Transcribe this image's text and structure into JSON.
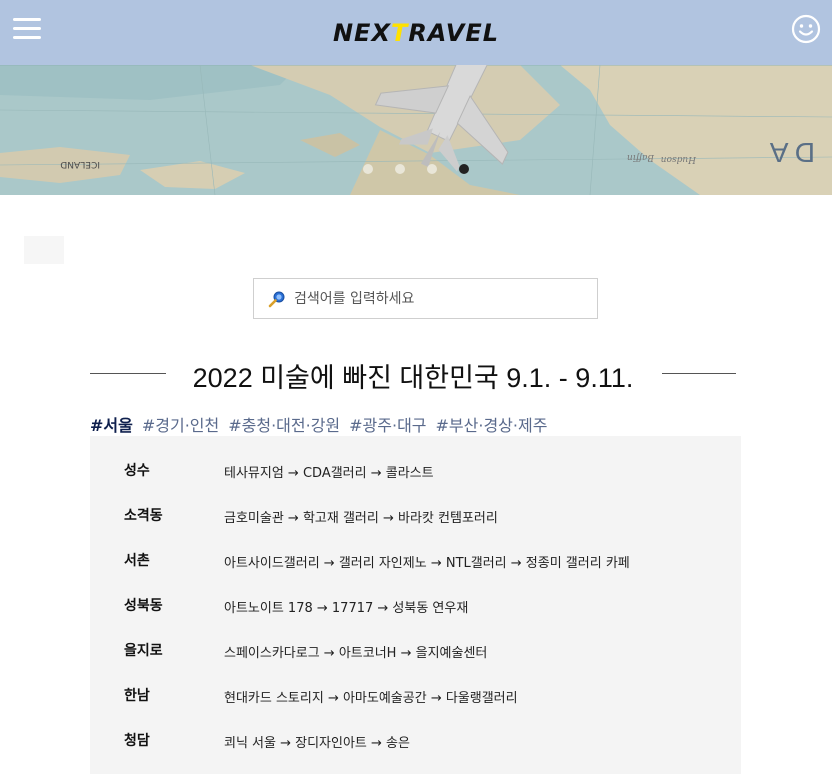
{
  "header": {
    "logo_prefix": "NEX",
    "logo_accent": "T",
    "logo_suffix": "RAVEL",
    "menu_icon": "hamburger-menu-icon",
    "profile_icon": "smiley-face-icon"
  },
  "banner": {
    "map_labels": [
      "ICELAND",
      "Baffin",
      "Hudson",
      "D A"
    ],
    "dots": [
      false,
      false,
      false,
      true
    ]
  },
  "search": {
    "placeholder": "검색어를 입력하세요",
    "icon": "magnifier-icon"
  },
  "section": {
    "title": "2022 미술에 빠진 대한민국 9.1. - 9.11."
  },
  "tabs": [
    {
      "label": "#서울",
      "active": true
    },
    {
      "label": "#경기·인천",
      "active": false
    },
    {
      "label": "#충청·대전·강원",
      "active": false
    },
    {
      "label": "#광주·대구",
      "active": false
    },
    {
      "label": "#부산·경상·제주",
      "active": false
    }
  ],
  "routes": [
    {
      "area": "성수",
      "path": "테사뮤지엄 → CDA갤러리 → 콜라스트"
    },
    {
      "area": "소격동",
      "path": "금호미술관 → 학고재 갤러리 → 바라캇 컨템포러리"
    },
    {
      "area": "서촌",
      "path": "아트사이드갤러리 → 갤러리 자인제노 → NTL갤러리 → 정종미 갤러리 카페"
    },
    {
      "area": "성북동",
      "path": "아트노이트 178 → 17717 → 성북동 연우재"
    },
    {
      "area": "을지로",
      "path": "스페이스카다로그 → 아트코너H → 을지예술센터"
    },
    {
      "area": "한남",
      "path": "현대카드 스토리지 → 아마도예술공간 → 다울랭갤러리"
    },
    {
      "area": "청담",
      "path": "쾨닉 서울 → 장디자인아트 → 송은"
    }
  ],
  "colors": {
    "header_bg": "#b1c4e0",
    "logo_accent": "#ffe100",
    "tab_active": "#0e1f4d",
    "tab_inactive": "#5a6a8c",
    "routes_bg": "#f4f4f4"
  }
}
